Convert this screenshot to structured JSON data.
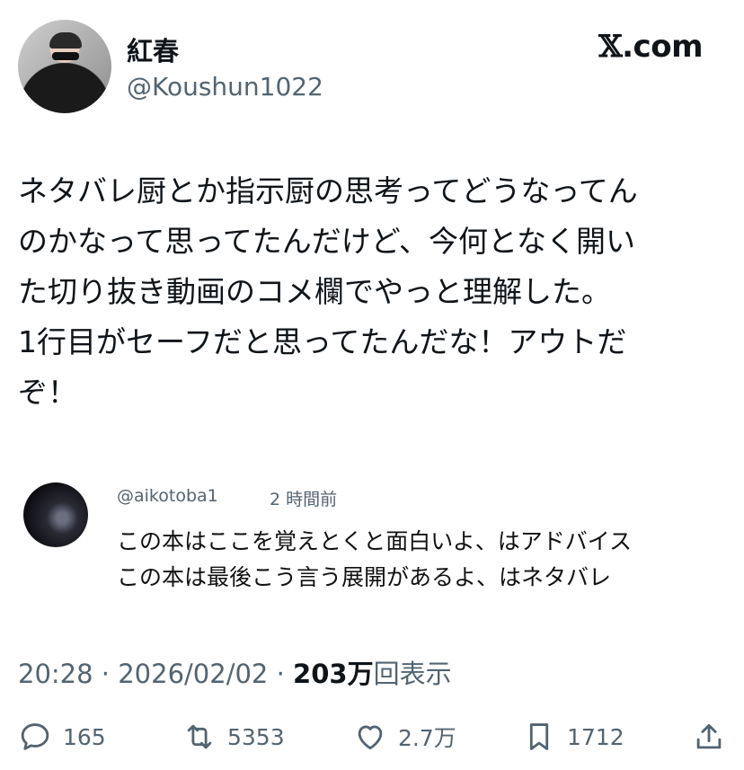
{
  "author": {
    "display_name": "紅春",
    "handle": "@Koushun1022"
  },
  "brand": {
    "x_glyph": "𝕏",
    "suffix": ".com"
  },
  "tweet": {
    "lines": [
      "ネタバレ厨とか指示厨の思考ってどうなってん",
      "のかなって思ってたんだけど、今何となく開い",
      "た切り抜き動画のコメ欄でやっと理解した。",
      "1行目がセーフだと思ってたんだな！アウトだ",
      "ぞ！"
    ]
  },
  "quoted_comment": {
    "handle": "@aikotoba1",
    "time": "2 時間前",
    "lines": [
      "この本はここを覚えとくと面白いよ、はアドバイス",
      "この本は最後こう言う展開があるよ、はネタバレ"
    ]
  },
  "meta": {
    "time": "20:28",
    "sep1": " · ",
    "date": "2026/02/02",
    "sep2": " · ",
    "views": "203万",
    "views_label": "回表示"
  },
  "actions": {
    "replies": "165",
    "reposts": "5353",
    "likes": "2.7万",
    "bookmarks": "1712"
  }
}
